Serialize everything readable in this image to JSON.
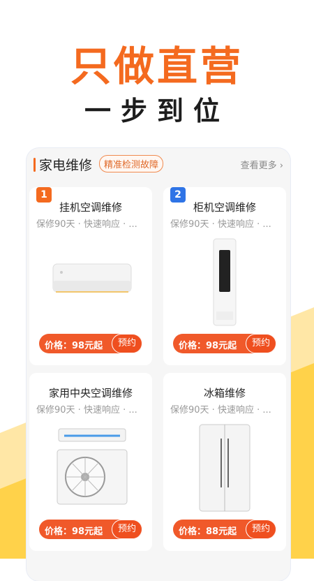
{
  "hero": {
    "title": "只做直营",
    "subtitle": "一步到位"
  },
  "section": {
    "title": "家电维修",
    "tag": "精准检测故障",
    "more": "查看更多"
  },
  "items": [
    {
      "rank": "1",
      "rank_color": "#f46a1f",
      "title": "挂机空调维修",
      "desc": "保修90天 · 快速响应 · ...",
      "price": "价格：98元起",
      "book": "预约",
      "icon": "wall-ac-icon"
    },
    {
      "rank": "2",
      "rank_color": "#2f74e6",
      "title": "柜机空调维修",
      "desc": "保修90天 · 快速响应 · ...",
      "price": "价格：98元起",
      "book": "预约",
      "icon": "tower-ac-icon"
    },
    {
      "rank": "",
      "rank_color": "",
      "title": "家用中央空调维修",
      "desc": "保修90天 · 快速响应 · ...",
      "price": "价格：98元起",
      "book": "预约",
      "icon": "central-ac-icon"
    },
    {
      "rank": "",
      "rank_color": "",
      "title": "冰箱维修",
      "desc": "保修90天 · 快速响应 · ...",
      "price": "价格：88元起",
      "book": "预约",
      "icon": "fridge-icon"
    }
  ],
  "colors": {
    "accent": "#f46a1f",
    "price_bg": "#f0592a",
    "yellow": "#ffd24a"
  }
}
